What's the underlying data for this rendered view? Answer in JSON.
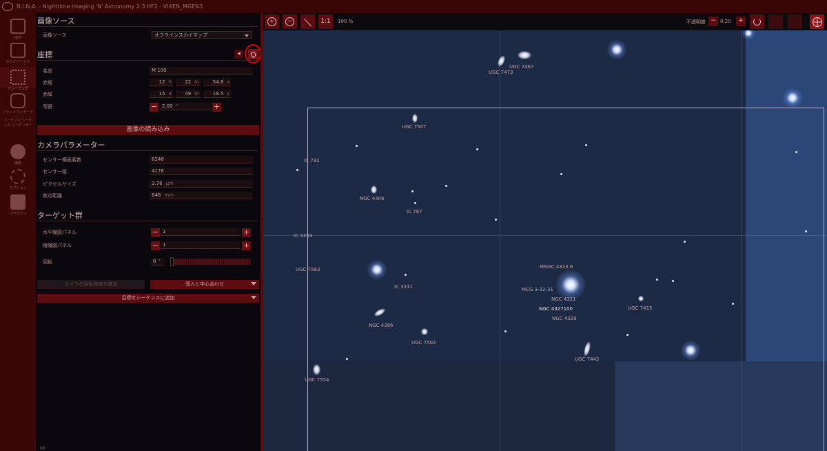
{
  "window": {
    "title": "N.I.N.A. - Nighttime Imaging 'N' Astronomy 2.3 HF2  -  VIXEN_MGEN3"
  },
  "nav": [
    {
      "label": "機材",
      "icon": "telescope-icon"
    },
    {
      "label": "スカイアトラス",
      "icon": "atlas-icon"
    },
    {
      "label": "フレーミング",
      "icon": "framing-icon"
    },
    {
      "label": "フラットウィザード",
      "icon": "flat-wizard-icon"
    },
    {
      "label": "シーケンス シーケンス シーケンサー",
      "icon": "sequence-icon"
    },
    {
      "label": "撮像",
      "icon": "imaging-icon"
    },
    {
      "label": "オプション",
      "icon": "gear-icon"
    },
    {
      "label": "プラグイン",
      "icon": "puzzle-icon"
    }
  ],
  "image_source": {
    "header": "画像ソース",
    "label": "画像ソース",
    "value": "オフラインスカイマップ"
  },
  "coordinates": {
    "header": "座標",
    "name_label": "名前",
    "name_value": "M 100",
    "ra_label": "赤経",
    "ra_h": "12",
    "ra_h_u": "h",
    "ra_m": "22",
    "ra_m_u": "m",
    "ra_s": "54.8",
    "ra_s_u": "s",
    "dec_label": "赤緯",
    "dec_d": "15",
    "dec_d_u": "d",
    "dec_m": "49",
    "dec_m_u": "m",
    "dec_s": "18.5",
    "dec_s_u": "s",
    "fov_label": "写野",
    "fov_value": "2.00",
    "fov_unit": "°",
    "load_button": "画像の読み込み"
  },
  "camera": {
    "header": "カメラパラメーター",
    "width_label": "センサー横画素数",
    "width_value": "6248",
    "height_label": "センサー縦",
    "height_value": "4176",
    "pixel_label": "ピクセルサイズ",
    "pixel_value": "3.76",
    "pixel_unit": "μm",
    "focal_label": "焦点距離",
    "focal_value": "648",
    "focal_unit": "mm"
  },
  "targets": {
    "header": "ターゲット群",
    "h_panels_label": "水平繊図パネル",
    "h_panels_value": "1",
    "v_panels_label": "縦繊図パネル",
    "v_panels_value": "1",
    "rotation_label": "回転",
    "rotation_value": "0",
    "rotation_unit": "°",
    "rotate_camera_button": "カメラの回転角度を確定",
    "slew_button": "導入と中心合わせ",
    "add_sequence_button": "目標をシーケンスに追加"
  },
  "toolbar": {
    "zoom_in": "+",
    "zoom_out": "−",
    "ratio": "1:1",
    "zoom": "100 %",
    "opacity_label": "不透明度",
    "opacity_minus": "−",
    "opacity_value": "0.20"
  },
  "map_labels": [
    "UGC 7467",
    "UGC 7473",
    "UGC 7507",
    "IC 782",
    "NGC 4406",
    "IC 787",
    "IC 3359",
    "UGC 7563",
    "IC 3311",
    "MNGC 4323.6",
    "MCG 3-32-31",
    "NGC 4321",
    "NGC 4327100",
    "NGC 4328",
    "UGC 7415",
    "NGC 4396",
    "UGC 7502",
    "UGC 7442",
    "UGC 7554"
  ],
  "footer": {
    "status": "00"
  }
}
